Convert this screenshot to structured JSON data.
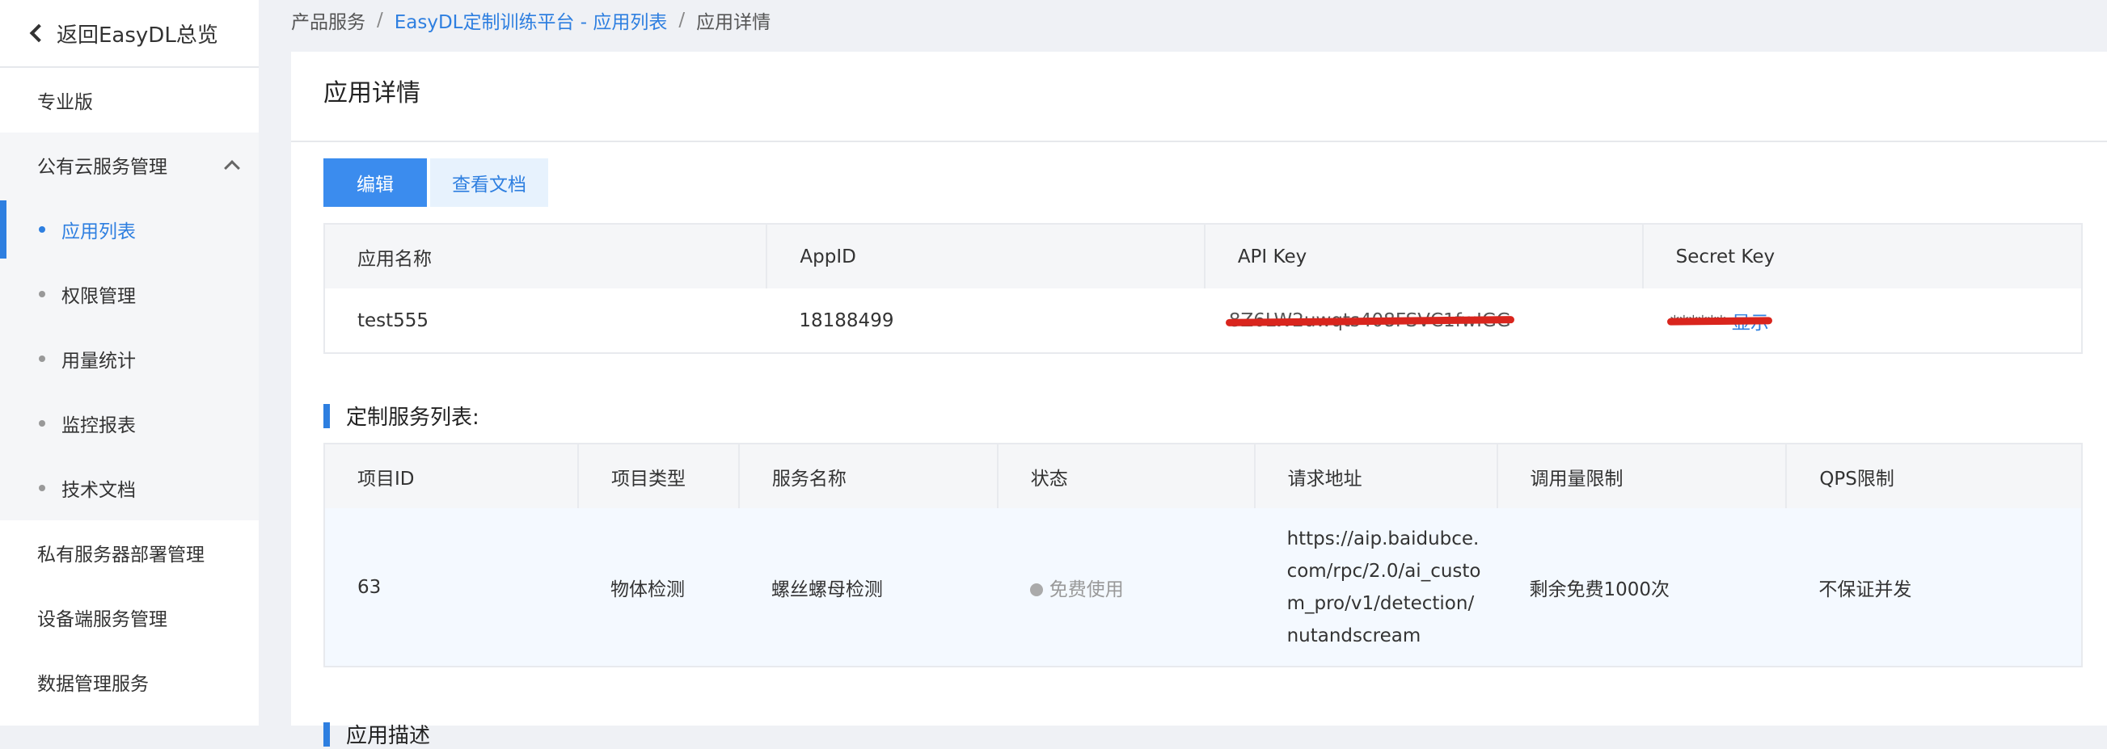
{
  "sidebar": {
    "back_label": "返回EasyDL总览",
    "items": [
      {
        "label": "专业版"
      },
      {
        "label": "公有云服务管理"
      },
      {
        "label": "应用列表"
      },
      {
        "label": "权限管理"
      },
      {
        "label": "用量统计"
      },
      {
        "label": "监控报表"
      },
      {
        "label": "技术文档"
      },
      {
        "label": "私有服务器部署管理"
      },
      {
        "label": "设备端服务管理"
      },
      {
        "label": "数据管理服务"
      }
    ]
  },
  "breadcrumb": {
    "items": [
      "产品服务",
      "EasyDL定制训练平台 - 应用列表",
      "应用详情"
    ],
    "separator": "/"
  },
  "page": {
    "title": "应用详情",
    "edit_label": "编辑",
    "docs_label": "查看文档"
  },
  "app_table": {
    "headers": [
      "应用名称",
      "AppID",
      "API Key",
      "Secret Key"
    ],
    "row": {
      "name": "test555",
      "app_id": "18188499",
      "api_key": "8Z6LW2uwqts408FSVC1fwIGG",
      "secret_key_mask": "******",
      "secret_show": "显示"
    }
  },
  "services": {
    "title": "定制服务列表:",
    "headers": [
      "项目ID",
      "项目类型",
      "服务名称",
      "状态",
      "请求地址",
      "调用量限制",
      "QPS限制"
    ],
    "rows": [
      {
        "project_id": "63",
        "project_type": "物体检测",
        "service_name": "螺丝螺母检测",
        "status": "免费使用",
        "url_lines": [
          "https://aip.baidubce.",
          "com/rpc/2.0/ai_custo",
          "m_pro/v1/detection/",
          "nutandscream"
        ],
        "call_limit": "剩余免费1000次",
        "qps_limit": "不保证并发"
      }
    ]
  },
  "next_section": {
    "title": "应用描述"
  },
  "colors": {
    "accent": "#2e7fe0",
    "primary_button": "#3b8cee",
    "redaction": "#d9251d"
  },
  "icons": {
    "back": "chevron-left-icon",
    "collapse": "chevron-up-icon"
  }
}
